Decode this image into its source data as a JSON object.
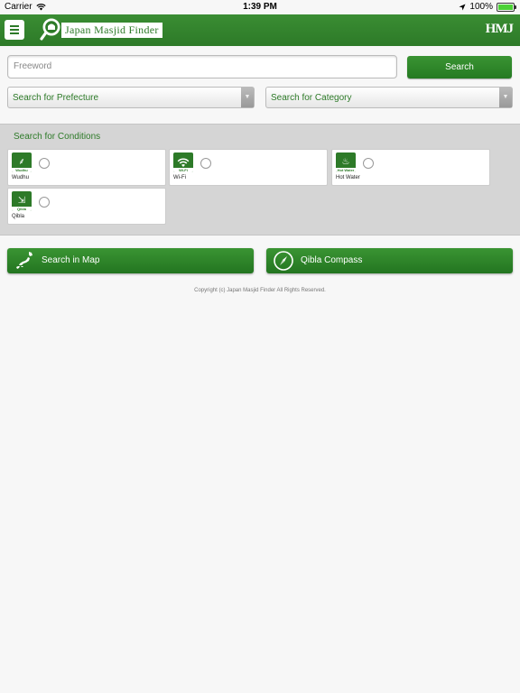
{
  "statusbar": {
    "carrier": "Carrier",
    "time": "1:39 PM",
    "battery": "100%"
  },
  "header": {
    "logo_text": "Japan Masjid Finder",
    "brand": "HMJ"
  },
  "search": {
    "placeholder": "Freeword",
    "button": "Search",
    "prefecture": "Search for Prefecture",
    "category": "Search for Category"
  },
  "conditions": {
    "title": "Search for Conditions",
    "items": [
      {
        "label": "Wudhu",
        "caption": "Wudhu"
      },
      {
        "label": "Wi-Fi",
        "caption": "Wi-Fi"
      },
      {
        "label": "Hot Water",
        "caption": "Hot Water"
      },
      {
        "label": "Qibla",
        "caption": "Qibla"
      }
    ]
  },
  "actions": {
    "map": "Search in Map",
    "compass": "Qibla Compass"
  },
  "footer": {
    "copyright": "Copyright (c) Japan Masjid Finder All Rights Reserved."
  },
  "colors": {
    "accent": "#2d7a28"
  }
}
